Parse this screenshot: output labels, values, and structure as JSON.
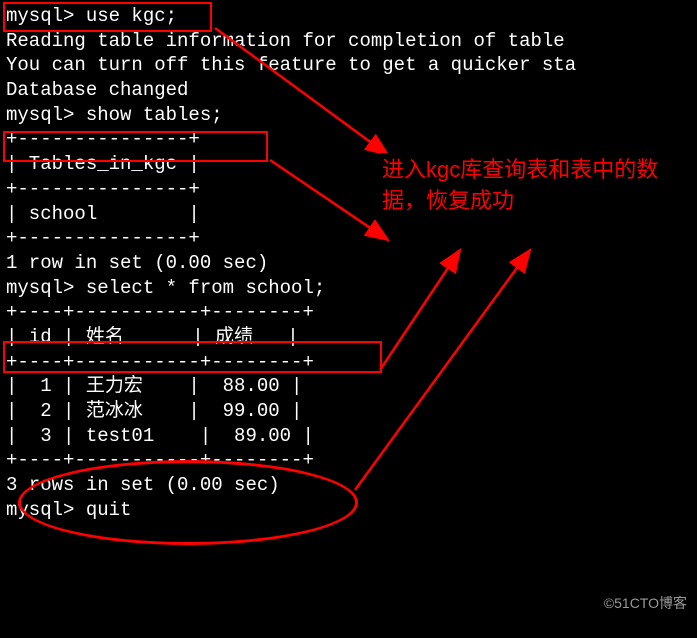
{
  "terminal": {
    "line1": "mysql> use kgc;",
    "line2": "Reading table information for completion of table ",
    "line3": "You can turn off this feature to get a quicker sta",
    "line4": "",
    "line5": "Database changed",
    "line6": "mysql> show tables;",
    "line7": "+---------------+",
    "line8": "| Tables_in_kgc |",
    "line9": "+---------------+",
    "line10": "| school        |",
    "line11": "+---------------+",
    "line12": "1 row in set (0.00 sec)",
    "line13": "",
    "line14": "mysql> select * from school;",
    "line15": "+----+-----------+--------+",
    "line16": "| id | 姓名      | 成绩   |",
    "line17": "+----+-----------+--------+",
    "line18": "|  1 | 王力宏    |  88.00 |",
    "line19": "|  2 | 范冰冰    |  99.00 |",
    "line20": "|  3 | test01    |  89.00 |",
    "line21": "+----+-----------+--------+",
    "line22": "3 rows in set (0.00 sec)",
    "line23": "",
    "line24": "mysql> quit"
  },
  "annotation": {
    "text": "进入kgc库查询表和表中的数据，恢复成功"
  },
  "watermark": "©51CTO博客",
  "commands": {
    "cmd1": "use kgc;",
    "cmd2": "show tables;",
    "cmd3": "select * from school;"
  },
  "chart_data": {
    "type": "table",
    "title": "school",
    "columns": [
      "id",
      "姓名",
      "成绩"
    ],
    "rows": [
      {
        "id": 1,
        "姓名": "王力宏",
        "成绩": 88.0
      },
      {
        "id": 2,
        "姓名": "范冰冰",
        "成绩": 99.0
      },
      {
        "id": 3,
        "姓名": "test01",
        "成绩": 89.0
      }
    ],
    "row_count": 3,
    "query_time_sec": 0.0
  },
  "tables_list": {
    "header": "Tables_in_kgc",
    "tables": [
      "school"
    ],
    "row_count": 1,
    "query_time_sec": 0.0
  }
}
